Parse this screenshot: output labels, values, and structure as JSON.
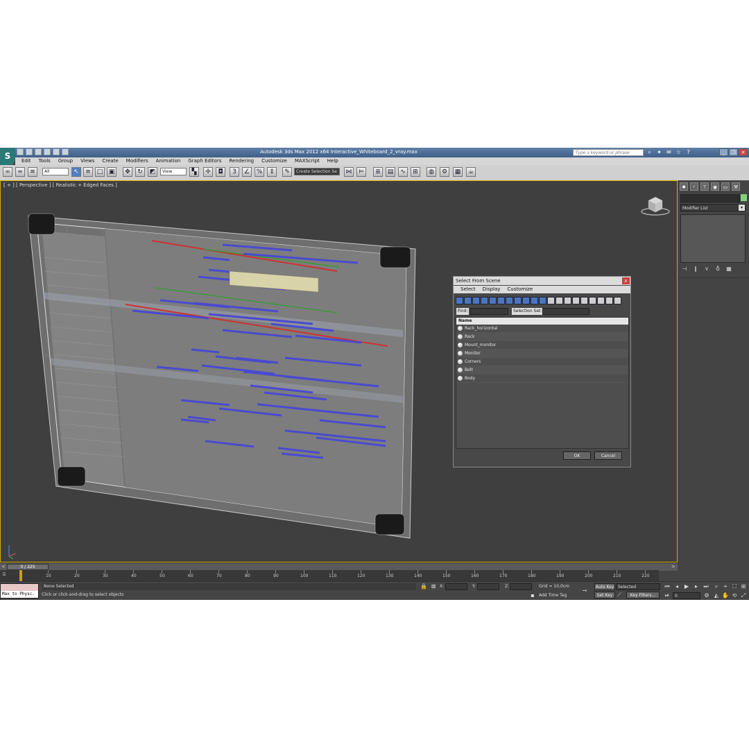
{
  "window": {
    "title": "Autodesk 3ds Max  2012 x64      Interactive_Whiteboard_2_vray.max",
    "search_placeholder": "Type a keyword or phrase"
  },
  "menu": [
    "Edit",
    "Tools",
    "Group",
    "Views",
    "Create",
    "Modifiers",
    "Animation",
    "Graph Editors",
    "Rendering",
    "Customize",
    "MAXScript",
    "Help"
  ],
  "toolbar": {
    "selection_filter": "All",
    "reference_coord": "View",
    "named_selection": "Create Selection Se"
  },
  "viewport": {
    "label": "[ + ] [ Perspective ] [ Realistic + Edged Faces ]"
  },
  "command_panel": {
    "modifier_list": "Modifier List"
  },
  "dialog": {
    "title": "Select From Scene",
    "close": "x",
    "menu": [
      "Select",
      "Display",
      "Customize"
    ],
    "find_label": "Find:",
    "selection_set_label": "Selection Set:",
    "column_name": "Name",
    "objects": [
      "Rack_horizontal",
      "Rack",
      "Mount_monitor",
      "Monitor",
      "Corners",
      "Bolt",
      "Body"
    ],
    "ok": "OK",
    "cancel": "Cancel"
  },
  "timeline": {
    "frame_display": "0 / 225",
    "ticks": [
      "10",
      "20",
      "30",
      "40",
      "50",
      "60",
      "70",
      "80",
      "90",
      "100",
      "110",
      "120",
      "130",
      "140",
      "150",
      "160",
      "170",
      "180",
      "190",
      "200",
      "210",
      "220"
    ]
  },
  "status": {
    "maxscript": "Max to Physc.",
    "selection": "None Selected",
    "prompt": "Click or click-and-drag to select objects",
    "x_label": "X:",
    "y_label": "Y:",
    "z_label": "Z:",
    "grid": "Grid = 10,0cm",
    "add_time_tag": "Add Time Tag",
    "auto_key": "Auto Key",
    "set_key": "Set Key",
    "key_mode": "Selected",
    "key_filters": "Key Filters...",
    "frame": "0"
  },
  "colors": {
    "viewport_bg": "#3f3f3f",
    "active_border": "#d4b000",
    "gantt_blue": "#4a4ad0",
    "gantt_red": "#d03030",
    "gantt_green": "#3a9a3a"
  }
}
